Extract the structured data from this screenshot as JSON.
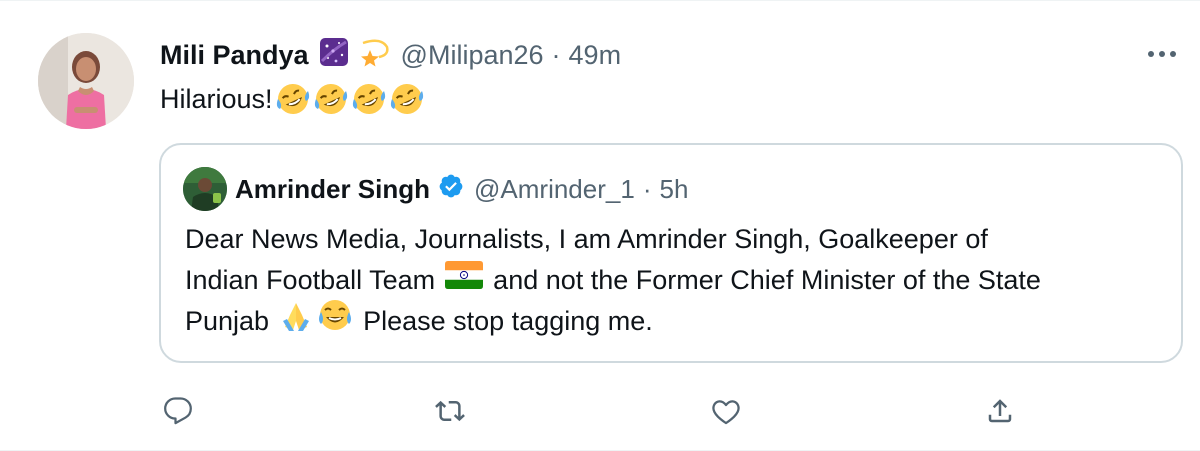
{
  "tweet": {
    "author_name": "Mili Pandya",
    "author_handle": "@Milipan26",
    "separator": "·",
    "time": "49m",
    "text": "Hilarious!",
    "name_badges": [
      "milky-way-emoji",
      "dizzy-star-emoji"
    ],
    "text_emojis": [
      "rofl-emoji",
      "rofl-emoji",
      "rofl-emoji",
      "rofl-emoji"
    ]
  },
  "quoted_tweet": {
    "author_name": "Amrinder Singh",
    "author_handle": "@Amrinder_1",
    "separator": "·",
    "time": "5h",
    "line1": "Dear News Media, Journalists, I am Amrinder Singh, Goalkeeper of",
    "line2_before_flag": "Indian Football Team",
    "line2_after_flag": "and not the Former Chief Minister of the State",
    "line3_before_emoji": "Punjab",
    "line3_after_emoji": "Please stop tagging me.",
    "inline_emojis": [
      "india-flag-emoji",
      "folded-hands-emoji",
      "tears-of-joy-emoji"
    ],
    "verified": true
  },
  "actions": [
    "reply-icon",
    "retweet-icon",
    "like-icon",
    "share-icon"
  ],
  "colors": {
    "text": "#0f1419",
    "secondary": "#536471",
    "border": "#cfd9de",
    "verified": "#1d9bf0",
    "background": "#ffffff"
  }
}
